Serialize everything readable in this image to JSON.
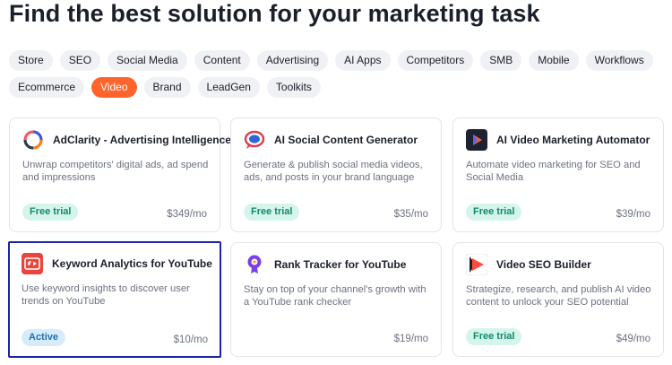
{
  "page": {
    "title": "Find the best solution for your marketing task"
  },
  "filters": {
    "row1": [
      "Store",
      "SEO",
      "Social Media",
      "Content",
      "Advertising",
      "AI Apps",
      "Competitors",
      "SMB",
      "Mobile",
      "Workflows"
    ],
    "row2": [
      "Ecommerce",
      "Video",
      "Brand",
      "LeadGen",
      "Toolkits"
    ],
    "active": "Video"
  },
  "cards": [
    {
      "name": "AdClarity - Advertising Intelligence",
      "desc": "Unwrap competitors' digital ads, ad spend and impressions",
      "badge": "Free trial",
      "price": "$349/mo",
      "icon": "adclarity-icon"
    },
    {
      "name": "AI Social Content Generator",
      "desc": "Generate & publish social media videos, ads, and posts in your brand language",
      "badge": "Free trial",
      "price": "$35/mo",
      "icon": "social-content-icon"
    },
    {
      "name": "AI Video Marketing Automator",
      "desc": "Automate video marketing for SEO and Social Media",
      "badge": "Free trial",
      "price": "$39/mo",
      "icon": "video-automator-icon"
    },
    {
      "name": "Keyword Analytics for YouTube",
      "desc": "Use keyword insights to discover user trends on YouTube",
      "badge": "Active",
      "price": "$10/mo",
      "icon": "youtube-keyword-icon"
    },
    {
      "name": "Rank Tracker for YouTube",
      "desc": "Stay on top of your channel's growth with a YouTube rank checker",
      "badge": "",
      "price": "$19/mo",
      "icon": "rank-tracker-icon"
    },
    {
      "name": "Video SEO Builder",
      "desc": "Strategize, research, and publish AI video content to unlock your SEO potential",
      "badge": "Free trial",
      "price": "$49/mo",
      "icon": "video-seo-icon"
    }
  ],
  "colors": {
    "accent": "#ff642d",
    "selected_border": "#1a24a8",
    "trial_bg": "#d5f5ec",
    "active_bg": "#d7ecfb"
  }
}
